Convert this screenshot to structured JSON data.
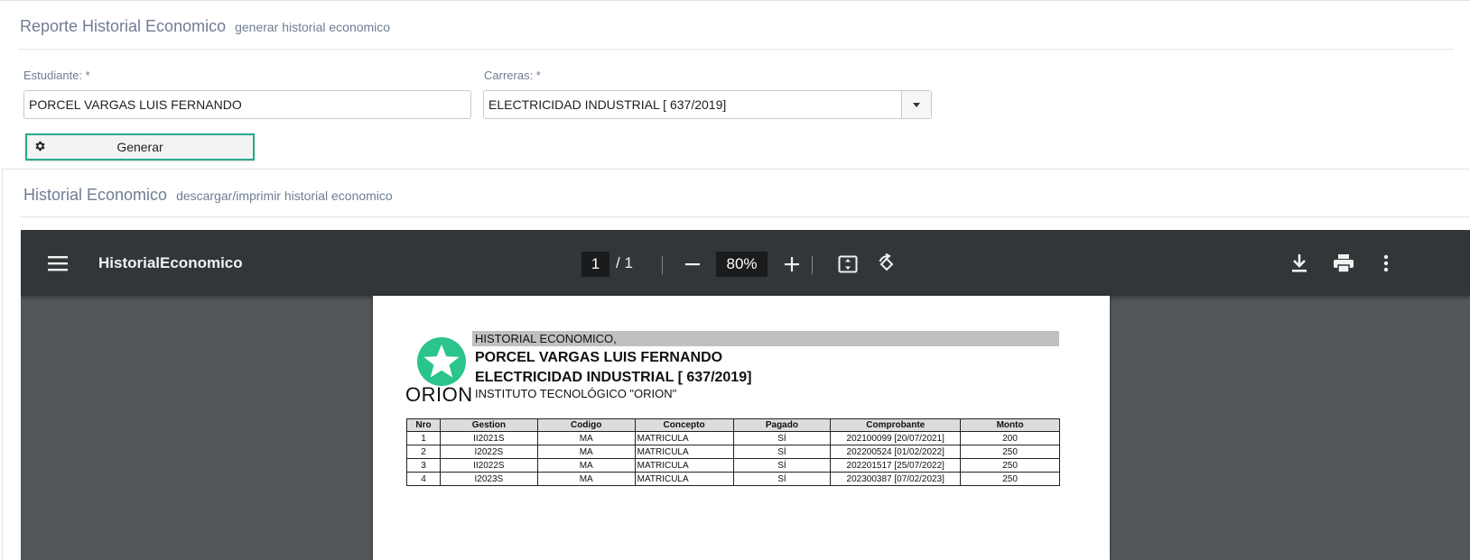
{
  "report": {
    "title": "Reporte Historial Economico",
    "subtitle": "generar historial economico",
    "student_label": "Estudiante: *",
    "student_value": "PORCEL VARGAS LUIS FERNANDO",
    "career_label": "Carreras: *",
    "career_value": "ELECTRICIDAD INDUSTRIAL [ 637/2019]",
    "generate_label": "Generar"
  },
  "history": {
    "title": "Historial Economico",
    "subtitle": "descargar/imprimir historial economico"
  },
  "viewer": {
    "doc_title": "HistorialEconomico",
    "page_current": "1",
    "page_separator": "/  1",
    "zoom": "80%"
  },
  "document": {
    "heading": "HISTORIAL ECONOMICO,",
    "student": "PORCEL VARGAS LUIS FERNANDO",
    "career": "ELECTRICIDAD INDUSTRIAL [ 637/2019]",
    "institute": "INSTITUTO TECNOLÓGICO  \"ORION\"",
    "logo_text": "ORION",
    "logo_color": "#2bc48a",
    "table": {
      "headers": [
        "Nro",
        "Gestion",
        "Codigo",
        "Concepto",
        "Pagado",
        "Comprobante",
        "Monto"
      ],
      "rows": [
        [
          "1",
          "II2021S",
          "MA",
          "MATRICULA",
          "SÍ",
          "202100099 [20/07/2021]",
          "200"
        ],
        [
          "2",
          "I2022S",
          "MA",
          "MATRICULA",
          "SÍ",
          "202200524 [01/02/2022]",
          "250"
        ],
        [
          "3",
          "II2022S",
          "MA",
          "MATRICULA",
          "SÍ",
          "202201517 [25/07/2022]",
          "250"
        ],
        [
          "4",
          "I2023S",
          "MA",
          "MATRICULA",
          "SÍ",
          "202300387 [07/02/2023]",
          "250"
        ]
      ]
    }
  },
  "colors": {
    "accent": "#2aa88a",
    "toolbar": "#323639",
    "viewer_bg": "#525659"
  }
}
